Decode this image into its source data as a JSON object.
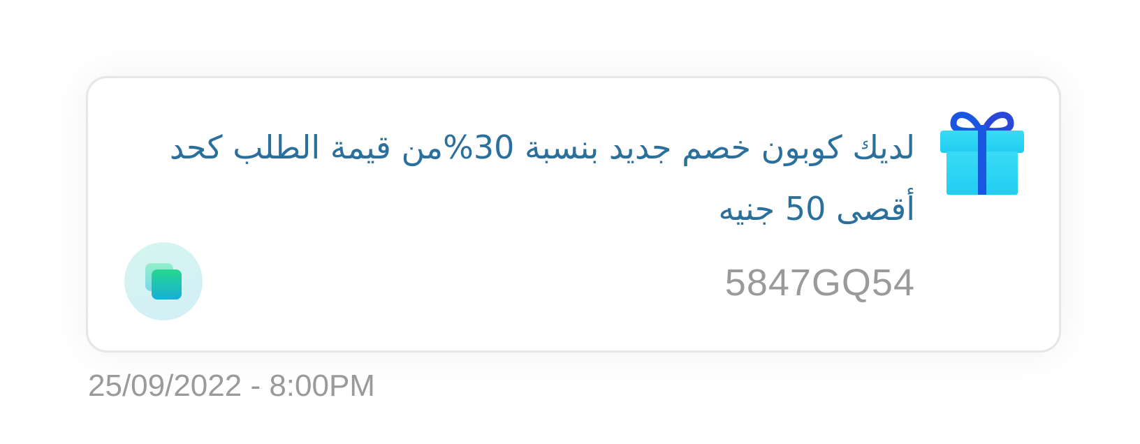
{
  "notification": {
    "message": "لديك كوبون خصم جديد بنسبة 30%من قيمة الطلب كحد أقصى 50 جنيه",
    "coupon_code": "5847GQ54",
    "timestamp": "25/09/2022 - 8:00PM",
    "icon": "gift-icon",
    "copy_icon": "copy-icon"
  },
  "colors": {
    "message_text": "#2b6f9c",
    "muted_text": "#9a9a9a",
    "gift_box": "#2fd3f1",
    "gift_ribbon": "#1a57e0",
    "copy_accent": "#1fc7a8"
  }
}
